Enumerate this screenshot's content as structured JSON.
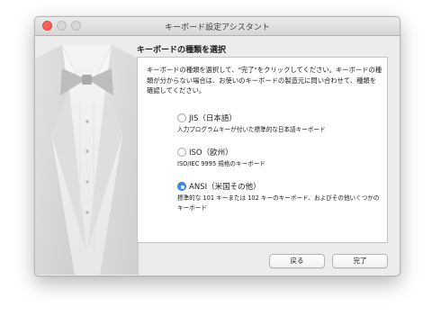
{
  "window": {
    "title": "キーボード設定アシスタント"
  },
  "page": {
    "heading": "キーボードの種類を選択",
    "description": "キーボードの種類を選択して、\"完了\"をクリックしてください。キーボードの種類が分からない場合は、お使いのキーボードの製造元に問い合わせて、種類を確認してください。"
  },
  "options": [
    {
      "label": "JIS（日本語）",
      "description": "入力プログラムキーが付いた標準的な日本語キーボード",
      "selected": false
    },
    {
      "label": "ISO（欧州）",
      "description": "ISO/IEC 9995 規格のキーボード",
      "selected": false
    },
    {
      "label": "ANSI（米国その他）",
      "description": "標準的な 101 キーまたは 102 キーのキーボード、およびその他いくつかのキーボード",
      "selected": true
    }
  ],
  "buttons": {
    "back": "戻る",
    "done": "完了"
  },
  "colors": {
    "accent": "#3b8ef7",
    "close": "#fc5f57"
  }
}
